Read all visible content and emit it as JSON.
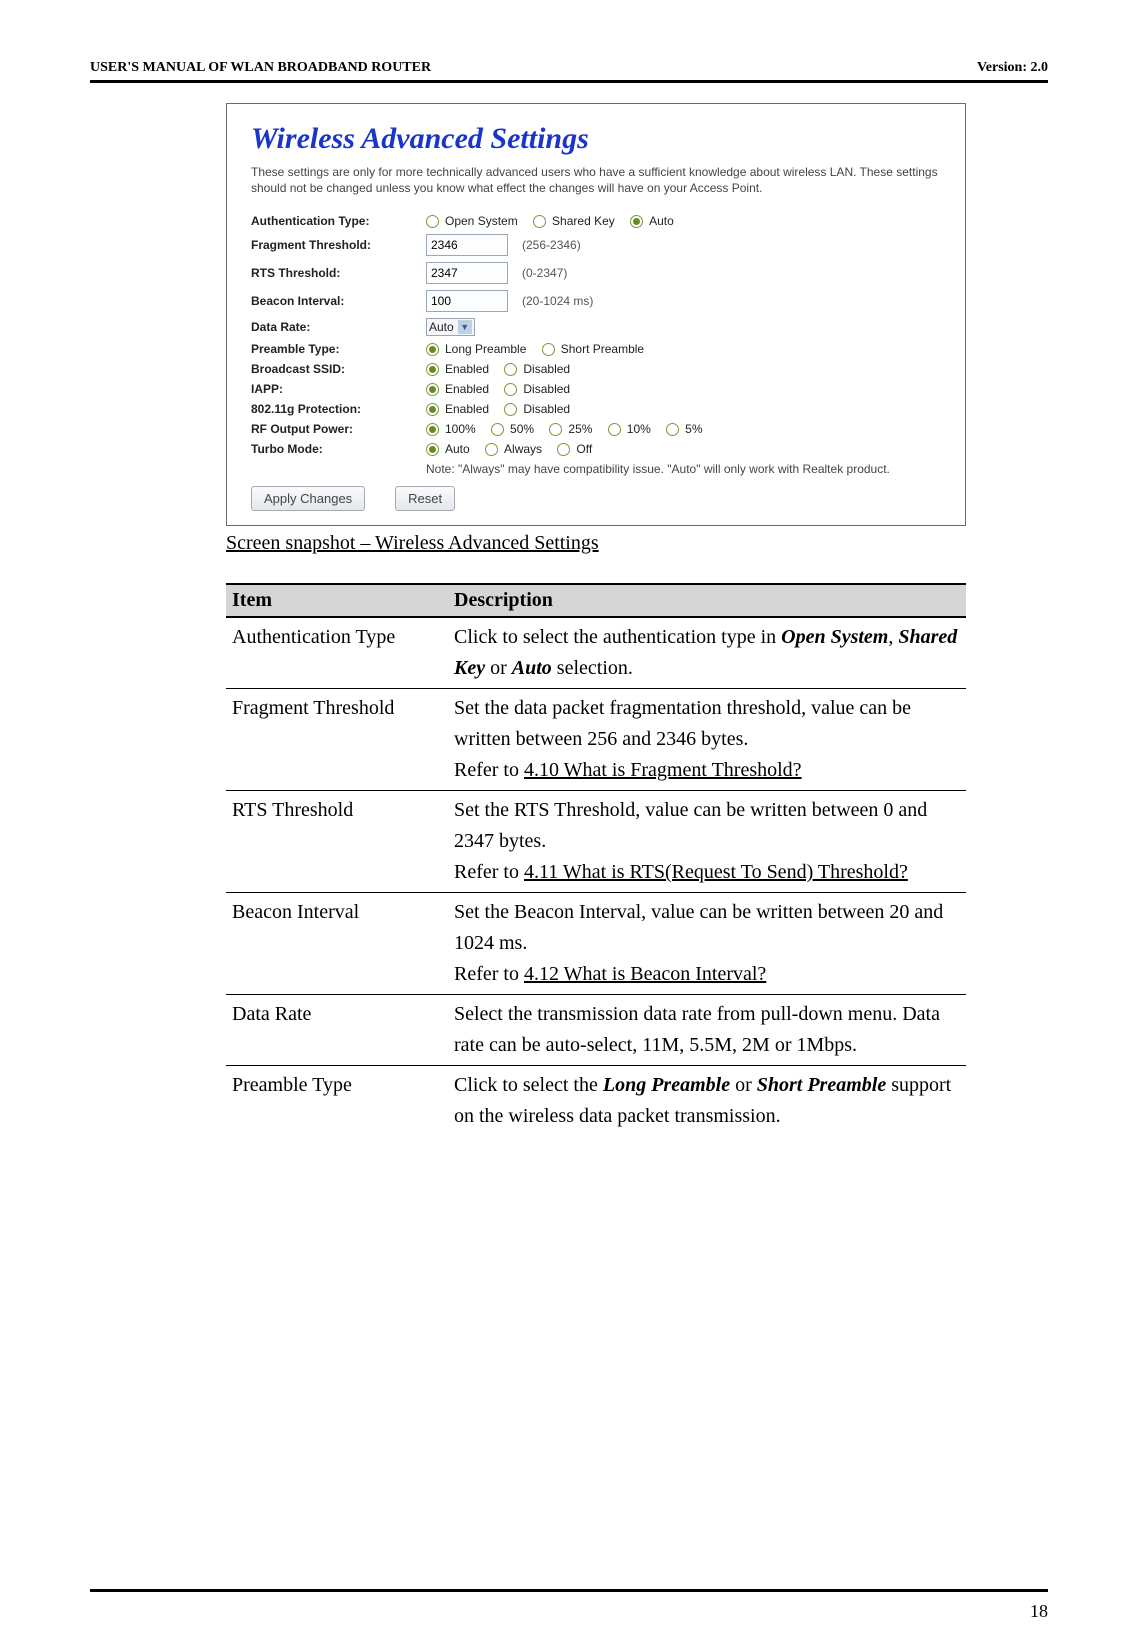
{
  "header": {
    "left": "USER'S MANUAL OF WLAN BROADBAND ROUTER",
    "right": "Version: 2.0"
  },
  "screenshot": {
    "title": "Wireless Advanced Settings",
    "description": "These settings are only for more technically advanced users who have a sufficient knowledge about wireless LAN. These settings should not be changed unless you know what effect the changes will have on your Access Point.",
    "rows": {
      "auth": {
        "label": "Authentication Type:",
        "opt1": "Open System",
        "opt2": "Shared Key",
        "opt3": "Auto"
      },
      "frag": {
        "label": "Fragment Threshold:",
        "value": "2346",
        "range": "(256-2346)"
      },
      "rts": {
        "label": "RTS Threshold:",
        "value": "2347",
        "range": "(0-2347)"
      },
      "beacon": {
        "label": "Beacon Interval:",
        "value": "100",
        "range": "(20-1024 ms)"
      },
      "rate": {
        "label": "Data Rate:",
        "value": "Auto"
      },
      "preamble": {
        "label": "Preamble Type:",
        "opt1": "Long Preamble",
        "opt2": "Short Preamble"
      },
      "bssid": {
        "label": "Broadcast SSID:",
        "opt1": "Enabled",
        "opt2": "Disabled"
      },
      "iapp": {
        "label": "IAPP:",
        "opt1": "Enabled",
        "opt2": "Disabled"
      },
      "prot": {
        "label": "802.11g Protection:",
        "opt1": "Enabled",
        "opt2": "Disabled"
      },
      "rf": {
        "label": "RF Output Power:",
        "o1": "100%",
        "o2": "50%",
        "o3": "25%",
        "o4": "10%",
        "o5": "5%"
      },
      "turbo": {
        "label": "Turbo Mode:",
        "o1": "Auto",
        "o2": "Always",
        "o3": "Off",
        "note": "Note: \"Always\" may have compatibility issue. \"Auto\" will only work with Realtek product."
      }
    },
    "buttons": {
      "apply": "Apply Changes",
      "reset": "Reset"
    }
  },
  "caption": "Screen snapshot – Wireless Advanced Settings",
  "table": {
    "header": {
      "item": "Item",
      "desc": "Description"
    },
    "rows": [
      {
        "item": "Authentication Type",
        "desc_pre": "Click to select the authentication type in ",
        "b1": "Open System",
        "mid1": ", ",
        "b2": "Shared Key",
        "mid2": " or ",
        "b3": "Auto",
        "desc_post": " selection."
      },
      {
        "item": "Fragment Threshold",
        "desc1": "Set the data packet fragmentation threshold, value can be written between 256 and 2346 bytes.",
        "refer": "Refer to ",
        "link": "4.10 What is Fragment Threshold?"
      },
      {
        "item": "RTS Threshold",
        "desc1": "Set the RTS Threshold, value can be written between 0 and 2347 bytes.",
        "refer": "Refer to ",
        "link": "4.11 What is RTS(Request To Send) Threshold?"
      },
      {
        "item": "Beacon Interval",
        "desc1": "Set the Beacon Interval, value can be written between 20 and 1024 ms.",
        "refer": "Refer to ",
        "link": "4.12 What is Beacon Interval?"
      },
      {
        "item": "Data Rate",
        "desc1": "Select the transmission data rate from pull-down menu. Data rate can be auto-select, 11M, 5.5M, 2M or 1Mbps."
      },
      {
        "item": "Preamble Type",
        "desc_pre": "Click to select the ",
        "b1": "Long Preamble",
        "mid1": " or ",
        "b2": "Short Preamble",
        "desc_post": " support on the wireless data packet transmission."
      }
    ]
  },
  "page_number": "18"
}
